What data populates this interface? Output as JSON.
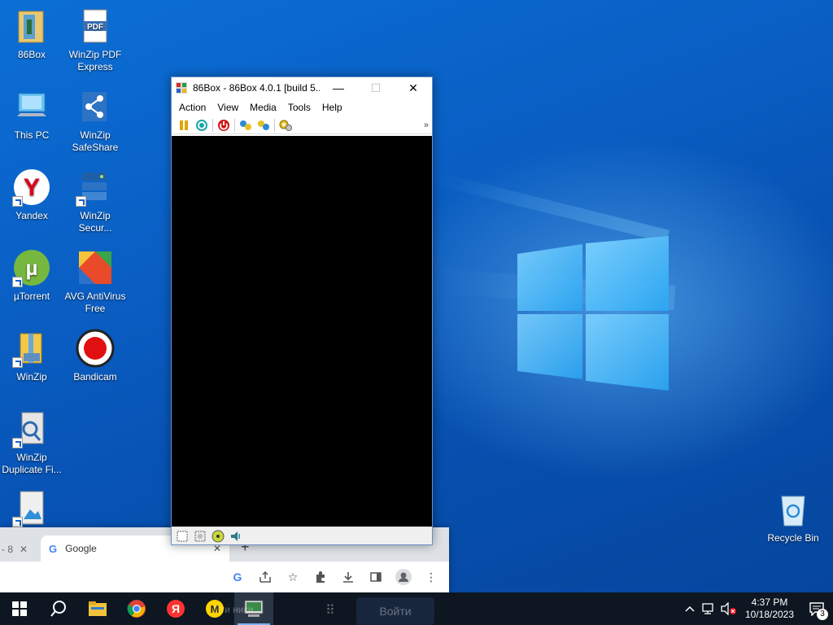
{
  "desktop": {
    "icons": [
      {
        "label": "86Box",
        "icon": "folder-icon"
      },
      {
        "label": "WinZip PDF Express",
        "icon": "winzip-pdf-icon"
      },
      {
        "label": "This PC",
        "icon": "computer-icon"
      },
      {
        "label": "WinZip SafeShare",
        "icon": "winzip-safeshare-icon"
      },
      {
        "label": "Yandex",
        "icon": "yandex-icon"
      },
      {
        "label": "WinZip Secur...",
        "icon": "winzip-secure-icon"
      },
      {
        "label": "µTorrent",
        "icon": "utorrent-icon"
      },
      {
        "label": "AVG AntiVirus Free",
        "icon": "avg-icon"
      },
      {
        "label": "WinZip",
        "icon": "winzip-icon"
      },
      {
        "label": "Bandicam",
        "icon": "bandicam-icon"
      },
      {
        "label": "WinZip Duplicate Fi...",
        "icon": "winzip-duplicate-icon"
      },
      {
        "label": "Recycle Bin",
        "icon": "recycle-bin-icon"
      }
    ]
  },
  "window86": {
    "title": "86Box - 86Box 4.0.1 [build 5...",
    "min_glyph": "—",
    "max_glyph": "☐",
    "close_glyph": "✕",
    "menu": [
      "Action",
      "View",
      "Media",
      "Tools",
      "Help"
    ],
    "toolbar": [
      "pause-icon",
      "reset-icon",
      "power-icon",
      "ctrl-alt-del-icon",
      "ctrl-alt-esc-icon",
      "settings-icon"
    ],
    "toolbar_more": "»"
  },
  "chrome": {
    "prev_tab_text": "- 8",
    "prev_tab_close": "✕",
    "active_tab_title": "Google",
    "active_tab_close": "✕",
    "newtab": "+",
    "g_glyph": "G"
  },
  "taskbar": {
    "time": "4:37 PM",
    "date": "10/18/2023",
    "notification_count": "3",
    "ghost_text_1": "Пти     ники",
    "ghost_text_2": "Войти"
  },
  "colors": {
    "accent": "#0b6fd6",
    "taskbar": "#0e1621"
  }
}
